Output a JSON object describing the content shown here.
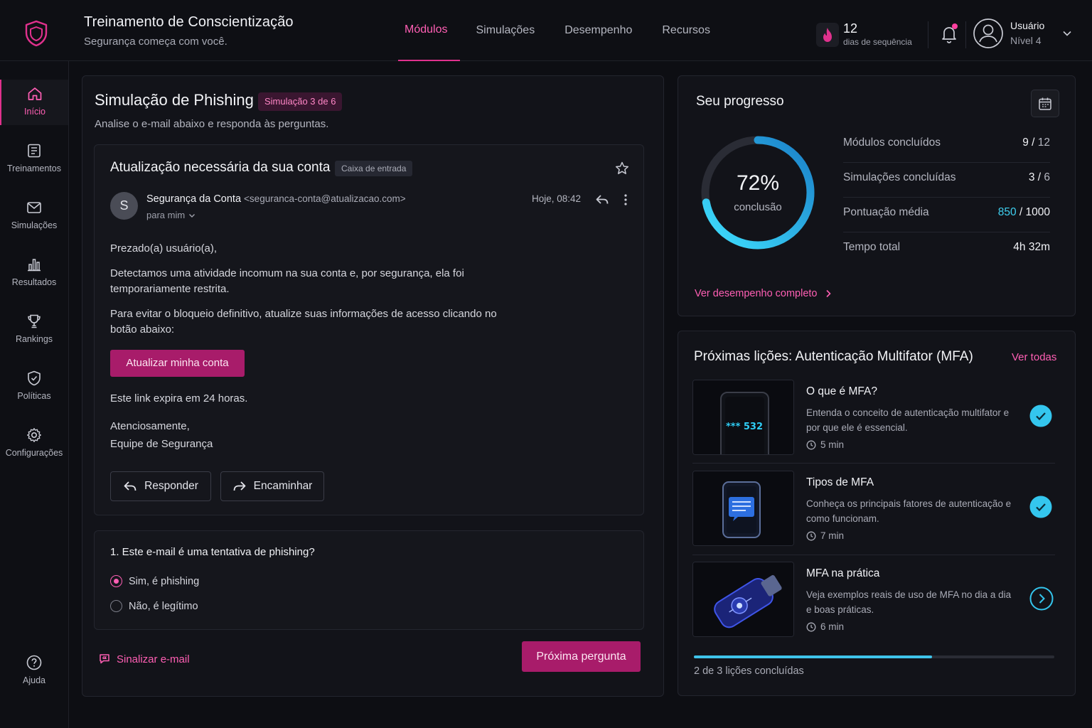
{
  "header": {
    "title": "Treinamento de Conscientização",
    "subtitle": "Segurança começa com você.",
    "nav": [
      {
        "label": "Módulos",
        "active": true
      },
      {
        "label": "Simulações",
        "active": false
      },
      {
        "label": "Desempenho",
        "active": false
      },
      {
        "label": "Recursos",
        "active": false
      }
    ],
    "streak": {
      "count": "12",
      "label": "dias de sequência"
    },
    "user": {
      "name": "Usuário",
      "level": "Nível 4"
    }
  },
  "sidebar": {
    "items": [
      {
        "label": "Início",
        "icon": "home-icon",
        "active": true
      },
      {
        "label": "Treinamentos",
        "icon": "book-icon",
        "active": false
      },
      {
        "label": "Simulações",
        "icon": "mail-icon",
        "active": false
      },
      {
        "label": "Resultados",
        "icon": "bar-chart-icon",
        "active": false
      },
      {
        "label": "Rankings",
        "icon": "trophy-icon",
        "active": false
      },
      {
        "label": "Políticas",
        "icon": "shield-check-icon",
        "active": false
      },
      {
        "label": "Configurações",
        "icon": "gear-icon",
        "active": false
      }
    ],
    "help_label": "Ajuda"
  },
  "simulation": {
    "title": "Simulação de Phishing",
    "badge": "Simulação 3 de 6",
    "instructions": "Analise o e-mail abaixo e responda às perguntas.",
    "email": {
      "subject": "Atualização necessária da sua conta",
      "folder": "Caixa de entrada",
      "sender_initial": "S",
      "sender_name": "Segurança da Conta",
      "sender_address": "<seguranca-conta@atualizacao.com>",
      "to": "para mim",
      "time": "Hoje, 08:42",
      "greeting": "Prezado(a) usuário(a),",
      "paragraph1": "Detectamos uma atividade incomum na sua conta e, por segurança, ela foi temporariamente restrita.",
      "paragraph2": "Para evitar o bloqueio definitivo, atualize suas informações de acesso clicando no botão abaixo:",
      "cta_label": "Atualizar minha conta",
      "expiry": "Este link expira em 24 horas.",
      "closing": "Atenciosamente,",
      "signature": "Equipe de Segurança",
      "reply_label": "Responder",
      "forward_label": "Encaminhar"
    },
    "question": {
      "text": "1. Este e-mail é uma tentativa de phishing?",
      "options": [
        {
          "label": "Sim, é phishing",
          "selected": true
        },
        {
          "label": "Não, é legítimo",
          "selected": false
        }
      ]
    },
    "report_label": "Sinalizar e-mail",
    "next_label": "Próxima pergunta"
  },
  "progress": {
    "title": "Seu progresso",
    "percent": 72,
    "percent_label": "72%",
    "completion_label": "conclusão",
    "stats": [
      {
        "label": "Módulos concluídos",
        "value": "9",
        "total": "12"
      },
      {
        "label": "Simulações concluídas",
        "value": "3",
        "total": "6"
      },
      {
        "label": "Pontuação média",
        "value": "850",
        "total": "1000"
      },
      {
        "label": "Tempo total",
        "value": "4h 32m"
      }
    ],
    "link_label": "Ver desempenho completo"
  },
  "lessons": {
    "title": "Próximas lições: Autenticação Multifator (MFA)",
    "see_all": "Ver todas",
    "items": [
      {
        "title": "O que é MFA?",
        "description": "Entenda o conceito de autenticação multifator e por que ele é essencial.",
        "duration": "5 min",
        "status": "completed",
        "thumb_text": "*** 532"
      },
      {
        "title": "Tipos de MFA",
        "description": "Conheça os principais fatores de autenticação e como funcionam.",
        "duration": "7 min",
        "status": "completed"
      },
      {
        "title": "MFA na prática",
        "description": "Veja exemplos reais de uso de MFA no dia a dia e boas práticas.",
        "duration": "6 min",
        "status": "next"
      }
    ],
    "completed_fraction": 0.66,
    "completed_label": "2 de 3 lições concluídas"
  },
  "colors": {
    "accent": "#e0318d",
    "accent_text": "#ff5fb4",
    "cyan": "#3fc4ea",
    "bg": "#0d0e13",
    "panel": "#121319"
  }
}
